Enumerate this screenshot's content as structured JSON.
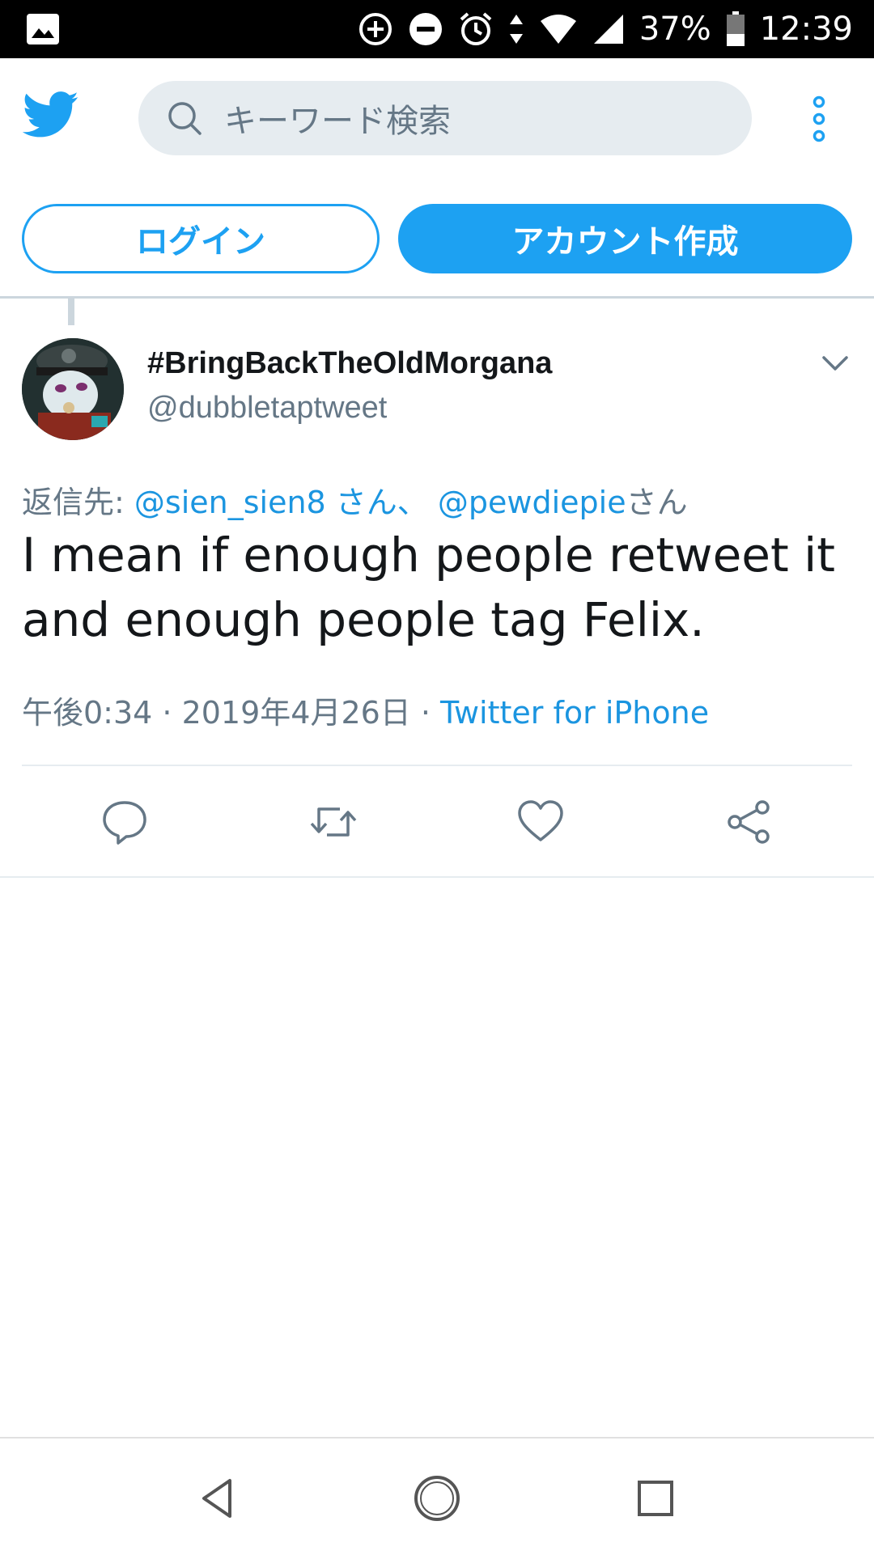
{
  "status_bar": {
    "battery": "37%",
    "time": "12:39"
  },
  "header": {
    "search_placeholder": "キーワード検索"
  },
  "buttons": {
    "login": "ログイン",
    "signup": "アカウント作成"
  },
  "tweet": {
    "display_name": "#BringBackTheOldMorgana",
    "handle": "@dubbletaptweet",
    "reply_prefix": "返信先: ",
    "reply_user1": "@sien_sien8 さん",
    "reply_sep": "、 ",
    "reply_user2": "@pewdiepie",
    "reply_suffix": "さん",
    "text": "I mean if enough people retweet it and enough people tag Felix.",
    "time": "午後0:34 · 2019年4月26日 · ",
    "source": "Twitter for iPhone"
  },
  "colors": {
    "accent": "#1da1f2",
    "link": "#1b95e0",
    "secondary_text": "#657786",
    "search_bg": "#e6ecf0"
  },
  "icons": {
    "status_left": "image-icon",
    "bird": "twitter-bird-icon",
    "search": "search-icon",
    "menu": "more-vertical-icon",
    "caret": "chevron-down-icon",
    "reply": "reply-icon",
    "retweet": "retweet-icon",
    "like": "heart-icon",
    "share": "share-icon"
  }
}
